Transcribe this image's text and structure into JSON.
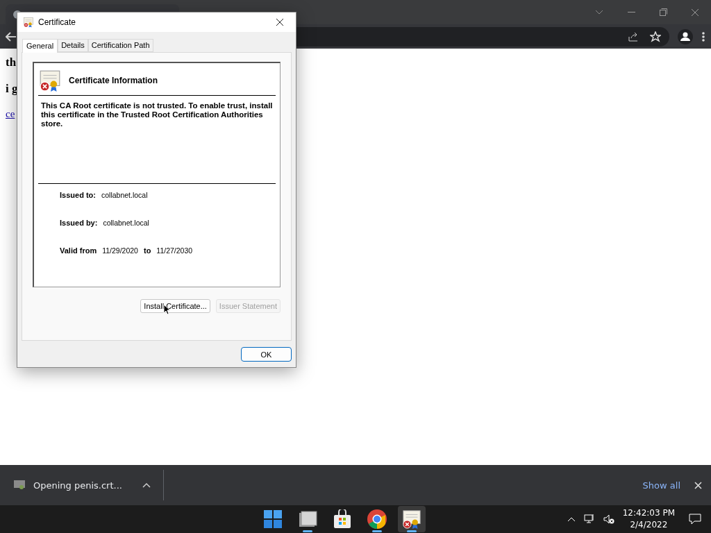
{
  "browser": {
    "page": {
      "lines": [
        "th",
        "i g"
      ],
      "link": "ce"
    },
    "downloads": {
      "item": "Opening penis.crt...",
      "show_all": "Show all"
    }
  },
  "dialog": {
    "title": "Certificate",
    "tabs": [
      {
        "label": "General",
        "selected": true
      },
      {
        "label": "Details",
        "selected": false
      },
      {
        "label": "Certification Path",
        "selected": false
      }
    ],
    "heading": "Certificate Information",
    "message": "This CA Root certificate is not trusted. To enable trust, install this certificate in the Trusted Root Certification Authorities store.",
    "fields": [
      {
        "label": "Issued to:",
        "value": "collabnet.local"
      },
      {
        "label": "Issued by:",
        "value": "collabnet.local"
      }
    ],
    "validity": {
      "label": "Valid from",
      "from": "11/29/2020",
      "to_label": "to",
      "to": "11/27/2030"
    },
    "buttons": [
      {
        "label": "Install Certificate...",
        "disabled": false
      },
      {
        "label": "Issuer Statement",
        "disabled": true
      }
    ],
    "ok": "OK"
  },
  "taskbar": {
    "apps": [
      {
        "kind": "start",
        "running": false,
        "active": false
      },
      {
        "kind": "files",
        "running": true,
        "active": false
      },
      {
        "kind": "store",
        "running": false,
        "active": false
      },
      {
        "kind": "chrome",
        "running": true,
        "active": false
      },
      {
        "kind": "certificate",
        "running": true,
        "active": true
      }
    ],
    "time": "12:42:03 PM",
    "date": "2/4/2022"
  }
}
